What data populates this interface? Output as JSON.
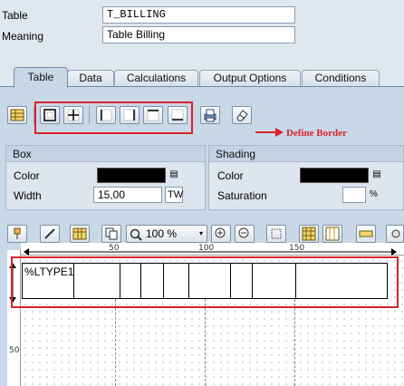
{
  "header": {
    "table_label": "Table",
    "table_value": "T_BILLING",
    "meaning_label": "Meaning",
    "meaning_value": "Table Billing"
  },
  "tabs": [
    {
      "label": "Table",
      "active": true
    },
    {
      "label": "Data",
      "active": false
    },
    {
      "label": "Calculations",
      "active": false
    },
    {
      "label": "Output Options",
      "active": false
    },
    {
      "label": "Conditions",
      "active": false
    }
  ],
  "annotation": {
    "text": "Define Border",
    "color": "#d9232a"
  },
  "box": {
    "title": "Box",
    "color_label": "Color",
    "color_value": "#000000",
    "width_label": "Width",
    "width_value": "15,00",
    "width_unit": "TW"
  },
  "shading": {
    "title": "Shading",
    "color_label": "Color",
    "color_value": "#000000",
    "saturation_label": "Saturation",
    "saturation_value": "",
    "saturation_unit": "%"
  },
  "editor": {
    "zoom": "100 %",
    "ruler_marks": [
      "50",
      "100",
      "150"
    ],
    "vruler_marks": [
      "50"
    ],
    "row_text": "%LTYPE1"
  },
  "icons": {
    "table-props": "grid-icon",
    "border-none": "frame-outer-icon",
    "border-all": "frame-inner-icon",
    "print": "print-icon",
    "eraser": "eraser-icon"
  }
}
